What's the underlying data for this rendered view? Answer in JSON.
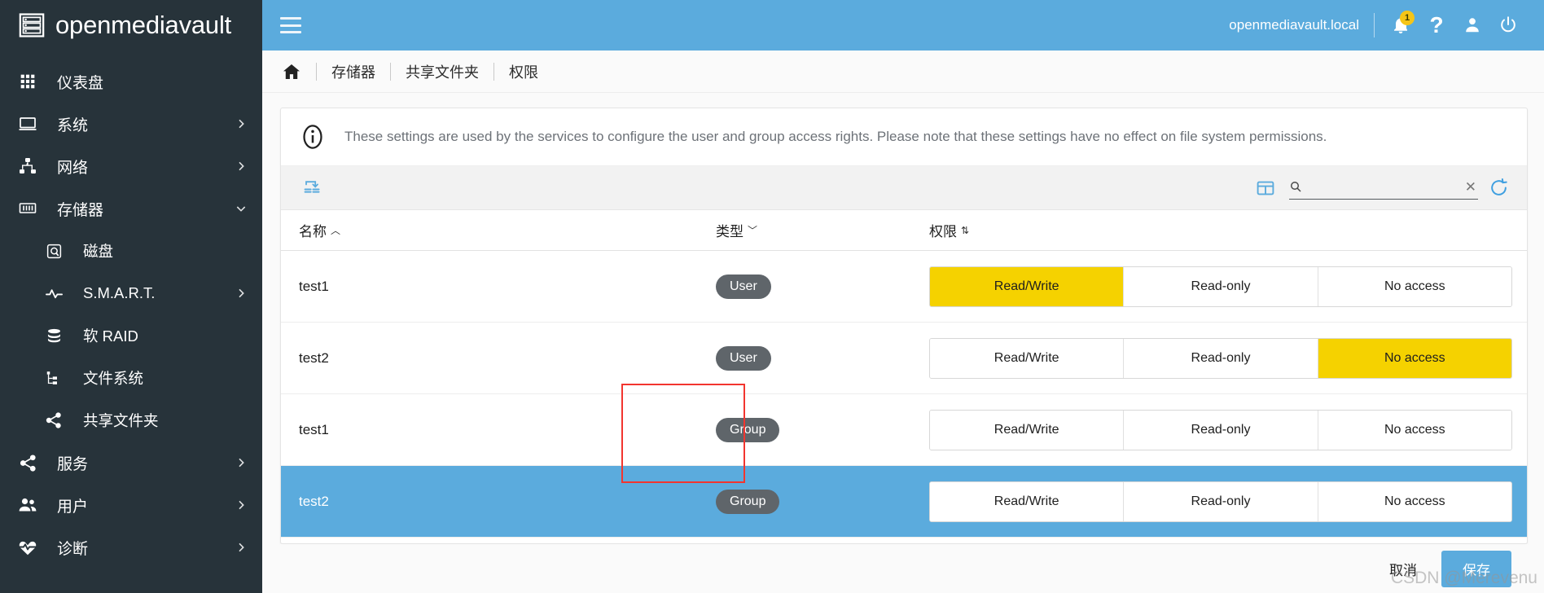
{
  "brand": {
    "name": "openmediavault",
    "logo_icon": "server-rack-icon"
  },
  "sidebar": {
    "items": [
      {
        "label": "仪表盘",
        "icon": "dashboard-grid-icon",
        "level": 0,
        "expandable": false,
        "state": ""
      },
      {
        "label": "系统",
        "icon": "monitor-icon",
        "level": 0,
        "expandable": true,
        "state": "collapsed"
      },
      {
        "label": "网络",
        "icon": "network-icon",
        "level": 0,
        "expandable": true,
        "state": "collapsed"
      },
      {
        "label": "存储器",
        "icon": "storage-icon",
        "level": 0,
        "expandable": true,
        "state": "expanded"
      },
      {
        "label": "磁盘",
        "icon": "hard-disk-icon",
        "level": 1,
        "expandable": false,
        "state": ""
      },
      {
        "label": "S.M.A.R.T.",
        "icon": "pulse-icon",
        "level": 1,
        "expandable": true,
        "state": "collapsed"
      },
      {
        "label": "软 RAID",
        "icon": "database-stack-icon",
        "level": 1,
        "expandable": false,
        "state": ""
      },
      {
        "label": "文件系统",
        "icon": "file-tree-icon",
        "level": 1,
        "expandable": false,
        "state": ""
      },
      {
        "label": "共享文件夹",
        "icon": "share-icon",
        "level": 1,
        "expandable": false,
        "state": ""
      },
      {
        "label": "服务",
        "icon": "share-icon",
        "level": 0,
        "expandable": true,
        "state": "collapsed"
      },
      {
        "label": "用户",
        "icon": "users-icon",
        "level": 0,
        "expandable": true,
        "state": "collapsed"
      },
      {
        "label": "诊断",
        "icon": "heart-pulse-icon",
        "level": 0,
        "expandable": true,
        "state": "collapsed"
      }
    ]
  },
  "topbar": {
    "menu_icon": "hamburger-menu-icon",
    "hostname": "openmediavault.local",
    "notification_icon": "bell-icon",
    "notification_count": "1",
    "help_icon": "question-mark-icon",
    "account_icon": "person-icon",
    "power_icon": "power-icon"
  },
  "breadcrumb": {
    "home_icon": "home-icon",
    "items": [
      "存储器",
      "共享文件夹",
      "权限"
    ]
  },
  "info": {
    "icon": "info-circle-icon",
    "message": "These settings are used by the services to configure the user and group access rights. Please note that these settings have no effect on file system permissions."
  },
  "toolbar": {
    "apply_icon": "sort-apply-icon",
    "columns_icon": "table-columns-icon",
    "search_icon": "search-icon",
    "clear_icon": "close-x-icon",
    "reload_icon": "refresh-icon",
    "search_value": "",
    "search_placeholder": ""
  },
  "table": {
    "columns": [
      {
        "label": "名称",
        "sort": "asc",
        "sort_glyph": "︿"
      },
      {
        "label": "类型",
        "sort": "desc",
        "sort_glyph": "﹀"
      },
      {
        "label": "权限",
        "sort": "none",
        "sort_glyph": "⇅"
      }
    ],
    "permission_options": [
      "Read/Write",
      "Read-only",
      "No access"
    ],
    "rows": [
      {
        "name": "test1",
        "type": "User",
        "permission": "Read/Write",
        "selected": false
      },
      {
        "name": "test2",
        "type": "User",
        "permission": "No access",
        "selected": false
      },
      {
        "name": "test1",
        "type": "Group",
        "permission": "",
        "selected": false
      },
      {
        "name": "test2",
        "type": "Group",
        "permission": "",
        "selected": true
      }
    ]
  },
  "footer": {
    "cancel_label": "取消",
    "save_label": "保存"
  },
  "annotation": {
    "watermark": "CSDN @Merevenu"
  },
  "colors": {
    "sidebar_bg": "#27333a",
    "accent_blue": "#5babdd",
    "highlight_yellow": "#f5d200",
    "chip_gray": "#5f656a",
    "annotation_red": "#f2352f"
  }
}
